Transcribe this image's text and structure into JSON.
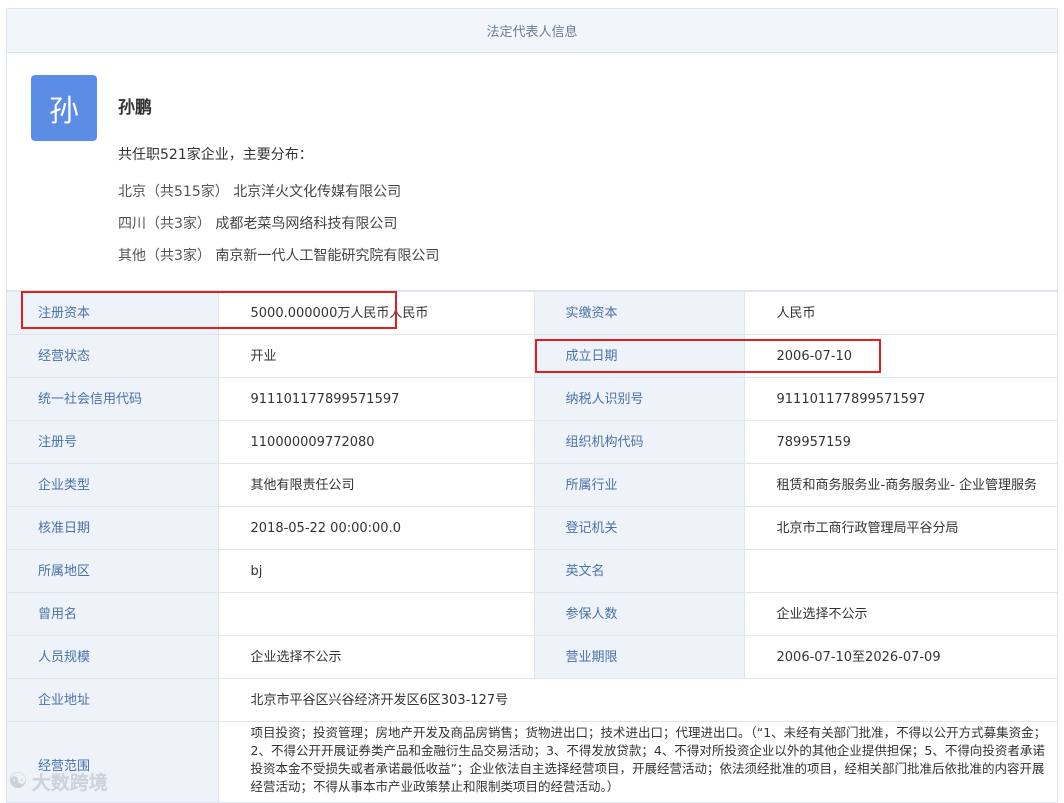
{
  "header": {
    "title": "法定代表人信息"
  },
  "person": {
    "avatar_char": "孙",
    "name": "孙鹏",
    "summary": "共任职521家企业，主要分布：",
    "distribution": [
      {
        "region": "北京（共515家）",
        "company": "北京洋火文化传媒有限公司"
      },
      {
        "region": "四川（共3家）",
        "company": "成都老菜鸟网络科技有限公司"
      },
      {
        "region": "其他（共3家）",
        "company": "南京新一代人工智能研究院有限公司"
      }
    ]
  },
  "rows": [
    {
      "l1": "注册资本",
      "v1": "5000.000000万人民币人民币",
      "l2": "实缴资本",
      "v2": "人民币"
    },
    {
      "l1": "经营状态",
      "v1": "开业",
      "l2": "成立日期",
      "v2": "2006-07-10"
    },
    {
      "l1": "统一社会信用代码",
      "v1": "911101177899571597",
      "l2": "纳税人识别号",
      "v2": "911101177899571597"
    },
    {
      "l1": "注册号",
      "v1": "110000009772080",
      "l2": "组织机构代码",
      "v2": "789957159"
    },
    {
      "l1": "企业类型",
      "v1": "其他有限责任公司",
      "l2": "所属行业",
      "v2": "租赁和商务服务业-商务服务业- 企业管理服务"
    },
    {
      "l1": "核准日期",
      "v1": "2018-05-22 00:00:00.0",
      "l2": "登记机关",
      "v2": "北京市工商行政管理局平谷分局"
    },
    {
      "l1": "所属地区",
      "v1": "bj",
      "l2": "英文名",
      "v2": ""
    },
    {
      "l1": "曾用名",
      "v1": "",
      "l2": "参保人数",
      "v2": "企业选择不公示"
    },
    {
      "l1": "人员规模",
      "v1": "企业选择不公示",
      "l2": "营业期限",
      "v2": "2006-07-10至2026-07-09"
    }
  ],
  "address": {
    "label": "企业地址",
    "value": "北京市平谷区兴谷经济开发区6区303-127号"
  },
  "scope": {
    "label": "经营范围",
    "value": "项目投资；投资管理；房地产开发及商品房销售；货物进出口；技术进出口；代理进出口。（“1、未经有关部门批准，不得以公开方式募集资金；2、不得公开开展证券类产品和金融衍生品交易活动；3、不得发放贷款；4、不得对所投资企业以外的其他企业提供担保；5、不得向投资者承诺投资本金不受损失或者承诺最低收益”；企业依法自主选择经营项目，开展经营活动；依法须经批准的项目，经相关部门批准后依批准的内容开展经营活动；不得从事本市产业政策禁止和限制类项目的经营活动。）"
  },
  "watermark": {
    "icon": "logo-icon",
    "text": "大数跨境"
  },
  "colors": {
    "highlight": "#e02020",
    "label_bg": "#eef3fa",
    "label_text": "#4a72a8",
    "avatar_bg": "#5b8de6"
  }
}
